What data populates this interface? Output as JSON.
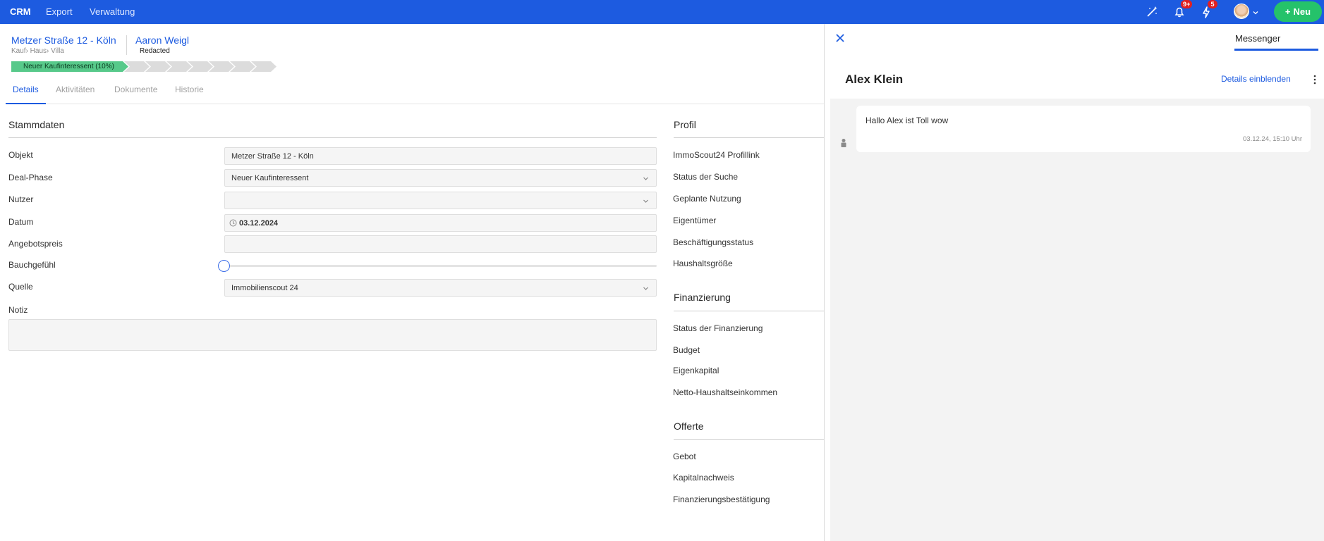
{
  "topbar": {
    "nav": [
      "CRM",
      "Export",
      "Verwaltung"
    ],
    "icons": [
      "magic-wand-icon",
      "bell-icon",
      "lightning-icon"
    ],
    "notifications_badge": "9+",
    "activity_badge": "5",
    "new_button": "Neu",
    "colors": {
      "bar": "#1d5be0",
      "new_button": "#25c26a",
      "badge": "#e32020"
    }
  },
  "header": {
    "title": "Metzer Straße 12 - Köln",
    "breadcrumb": "Kauf› Haus› Villa",
    "contact_name": "Aaron Weigl",
    "contact_sub": "Redacted",
    "pipeline_stage": "Neuer Kaufinteressent (10%)",
    "pipeline_progress": 0.1
  },
  "tabs": [
    "Details",
    "Aktivitäten",
    "Dokumente",
    "Historie"
  ],
  "stammdaten": {
    "title": "Stammdaten",
    "labels": {
      "objekt": "Objekt",
      "deal_phase": "Deal-Phase",
      "nutzer": "Nutzer",
      "datum": "Datum",
      "angebotspreis": "Angebotspreis",
      "bauchgefuehl": "Bauchgefühl",
      "quelle": "Quelle",
      "notiz": "Notiz"
    },
    "values": {
      "objekt": "Metzer Straße 12 - Köln",
      "deal_phase": "Neuer Kaufinteressent",
      "nutzer": "",
      "datum": "03.12.2024",
      "angebotspreis": "",
      "bauchgefuehl": 0,
      "quelle": "Immobilienscout 24",
      "notiz": ""
    }
  },
  "profil": {
    "title": "Profil",
    "items": [
      "ImmoScout24 Profillink",
      "Status der Suche",
      "Geplante Nutzung",
      "Eigentümer",
      "Beschäftigungsstatus",
      "Haushaltsgröße"
    ]
  },
  "finanzierung": {
    "title": "Finanzierung",
    "items": [
      "Status der Finanzierung",
      "Budget",
      "Eigenkapital",
      "Netto-Haushaltseinkommen"
    ]
  },
  "offerte": {
    "title": "Offerte",
    "items": [
      "Gebot",
      "Kapitalnachweis",
      "Finanzierungsbestätigung"
    ]
  },
  "messenger": {
    "tab": "Messenger",
    "contact": "Alex Klein",
    "details_link": "Details einblenden",
    "messages": [
      {
        "text": "Hallo Alex ist Toll wow",
        "time": "03.12.24, 15:10 Uhr"
      }
    ]
  }
}
